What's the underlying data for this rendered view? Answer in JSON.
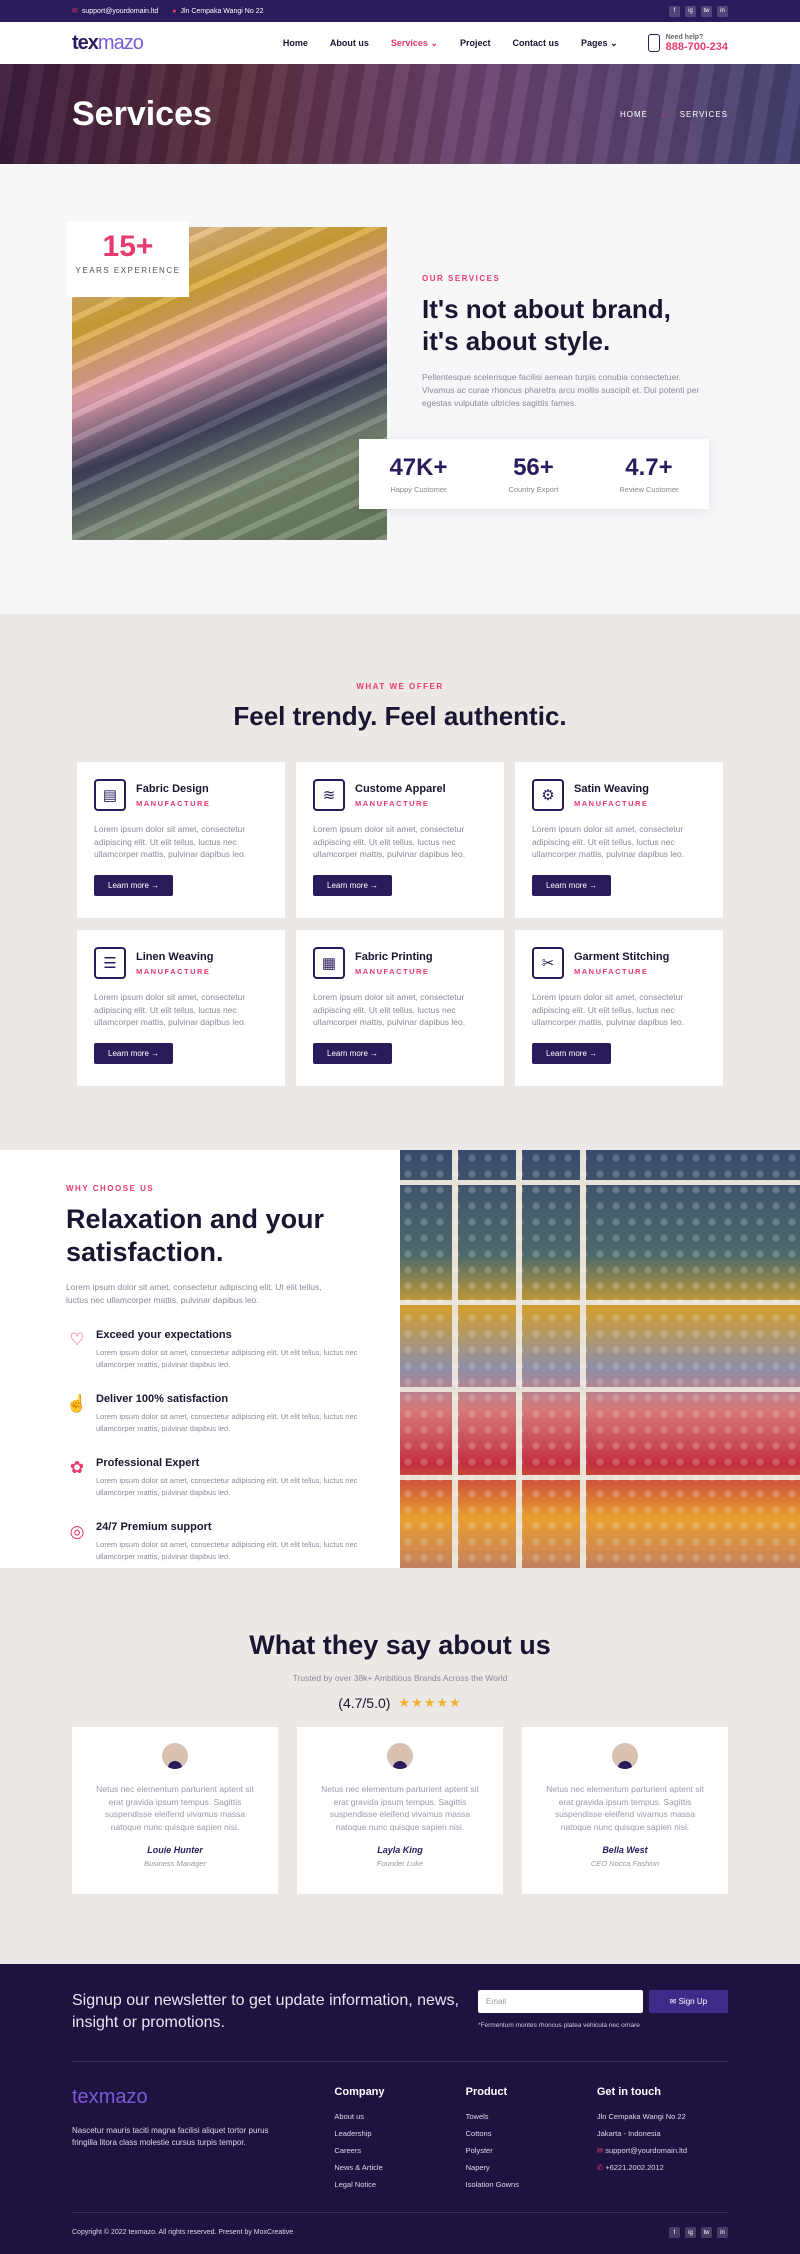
{
  "topbar": {
    "email": "support@yourdomain.ltd",
    "address": "Jln Cempaka Wangi No 22",
    "social": [
      "f",
      "ig",
      "tw",
      "in"
    ]
  },
  "brand": {
    "logo_a": "tex",
    "logo_b": "mazo"
  },
  "nav": {
    "items": [
      "Home",
      "About us",
      "Services",
      "Project",
      "Contact us",
      "Pages"
    ],
    "active": "Services",
    "help_label": "Need help?",
    "phone": "888-700-234"
  },
  "hero": {
    "title": "Services",
    "crumb_home": "HOME",
    "crumb_current": "SERVICES"
  },
  "about": {
    "years": "15+",
    "years_label": "YEARS EXPERIENCE",
    "eyebrow": "OUR SERVICES",
    "title": "It's not about brand, it's about style.",
    "text": "Pellentesque scelerisque facilisi aenean turpis conubia consectetuer. Vivamus ac curae rhoncus pharetra arcu mollis suscipit et. Dui potenti per egestas vulputate ultricies sagittis fames.",
    "stats": [
      {
        "value": "47K+",
        "label": "Happy Customer"
      },
      {
        "value": "56+",
        "label": "Country Export"
      },
      {
        "value": "4.7+",
        "label": "Review Customer"
      }
    ]
  },
  "offer": {
    "eyebrow": "WHAT WE OFFER",
    "title": "Feel trendy. Feel authentic.",
    "cards": [
      {
        "title": "Fabric Design",
        "sub": "MANUFACTURE",
        "text": "Lorem ipsum dolor sit amet, consectetur adipiscing elit. Ut elit tellus, luctus nec ullamcorper mattis, pulvinar dapibus leo.",
        "btn": "Learn more →",
        "icon": "fabric-design-icon"
      },
      {
        "title": "Custome Apparel",
        "sub": "MANUFACTURE",
        "text": "Lorem ipsum dolor sit amet, consectetur adipiscing elit. Ut elit tellus, luctus nec ullamcorper mattis, pulvinar dapibus leo.",
        "btn": "Learn more →",
        "icon": "fabric-roll-icon"
      },
      {
        "title": "Satin Weaving",
        "sub": "MANUFACTURE",
        "text": "Lorem ipsum dolor sit amet, consectetur adipiscing elit. Ut elit tellus, luctus nec ullamcorper mattis, pulvinar dapibus leo.",
        "btn": "Learn more →",
        "icon": "sewing-machine-icon"
      },
      {
        "title": "Linen Weaving",
        "sub": "MANUFACTURE",
        "text": "Lorem ipsum dolor sit amet, consectetur adipiscing elit. Ut elit tellus, luctus nec ullamcorper mattis, pulvinar dapibus leo.",
        "btn": "Learn more →",
        "icon": "fabric-stack-icon"
      },
      {
        "title": "Fabric Printing",
        "sub": "MANUFACTURE",
        "text": "Lorem ipsum dolor sit amet, consectetur adipiscing elit. Ut elit tellus, luctus nec ullamcorper mattis, pulvinar dapibus leo.",
        "btn": "Learn more →",
        "icon": "printing-machine-icon"
      },
      {
        "title": "Garment Stitching",
        "sub": "MANUFACTURE",
        "text": "Lorem ipsum dolor sit amet, consectetur adipiscing elit. Ut elit tellus, luctus nec ullamcorper mattis, pulvinar dapibus leo.",
        "btn": "Learn more →",
        "icon": "stitching-machine-icon"
      }
    ]
  },
  "why": {
    "eyebrow": "WHY CHOOSE US",
    "title": "Relaxation and your satisfaction.",
    "lead": "Lorem ipsum dolor sit amet, consectetur adipiscing elit. Ut elit tellus, luctus nec ullamcorper mattis, pulvinar dapibus leo.",
    "features": [
      {
        "title": "Exceed your expectations",
        "text": "Lorem ipsum dolor sit amet, consectetur adipiscing elit. Ut elit tellus, luctus nec ullamcorper mattis, pulvinar dapibus leo."
      },
      {
        "title": "Deliver 100% satisfaction",
        "text": "Lorem ipsum dolor sit amet, consectetur adipiscing elit. Ut elit tellus, luctus nec ullamcorper mattis, pulvinar dapibus leo."
      },
      {
        "title": "Professional Expert",
        "text": "Lorem ipsum dolor sit amet, consectetur adipiscing elit. Ut elit tellus, luctus nec ullamcorper mattis, pulvinar dapibus leo."
      },
      {
        "title": "24/7 Premium support",
        "text": "Lorem ipsum dolor sit amet, consectetur adipiscing elit. Ut elit tellus, luctus nec ullamcorper mattis, pulvinar dapibus leo."
      }
    ]
  },
  "testimonials": {
    "title": "What they say about us",
    "sub": "Trusted by over 38k+ Ambitious Brands Across the World",
    "rating": "(4.7/5.0)",
    "stars": "★★★★★",
    "items": [
      {
        "quote": "Netus nec elementum parturient aptent sit erat gravida ipsum tempus. Sagittis suspendisse eleifend vivamus massa natoque nunc quisque sapien nisi.",
        "name": "Louie Hunter",
        "role": "Business Manager"
      },
      {
        "quote": "Netus nec elementum parturient aptent sit erat gravida ipsum tempus. Sagittis suspendisse eleifend vivamus massa natoque nunc quisque sapien nisi.",
        "name": "Layla King",
        "role": "Founder Luke"
      },
      {
        "quote": "Netus nec elementum parturient aptent sit erat gravida ipsum tempus. Sagittis suspendisse eleifend vivamus massa natoque nunc quisque sapien nisi.",
        "name": "Bella West",
        "role": "CEO Nocca Fashion"
      }
    ]
  },
  "footer": {
    "news_text": "Signup our newsletter to get update information, news, insight or promotions.",
    "email_placeholder": "Email",
    "signup": "✉ Sign Up",
    "note": "*Fermentum montes rhoncus platea vehicula nec ornare",
    "about": "Nascetur mauris taciti magna facilisi aliquet tortor purus fringilla litora class molestie cursus turpis tempor.",
    "company_title": "Company",
    "company": [
      "About us",
      "Leadership",
      "Careers",
      "News & Article",
      "Legal Notice"
    ],
    "product_title": "Product",
    "product": [
      "Towels",
      "Cottons",
      "Polyster",
      "Napery",
      "Isolation Gowns"
    ],
    "contact_title": "Get in touch",
    "contact": [
      "Jln Cempaka Wangi No 22",
      "Jakarta - Indonesia",
      "support@yourdomain.ltd",
      "+6221.2002.2012"
    ],
    "copyright": "Copyright © 2022 texmazo. All rights reserved. Present by MoxCreative"
  }
}
